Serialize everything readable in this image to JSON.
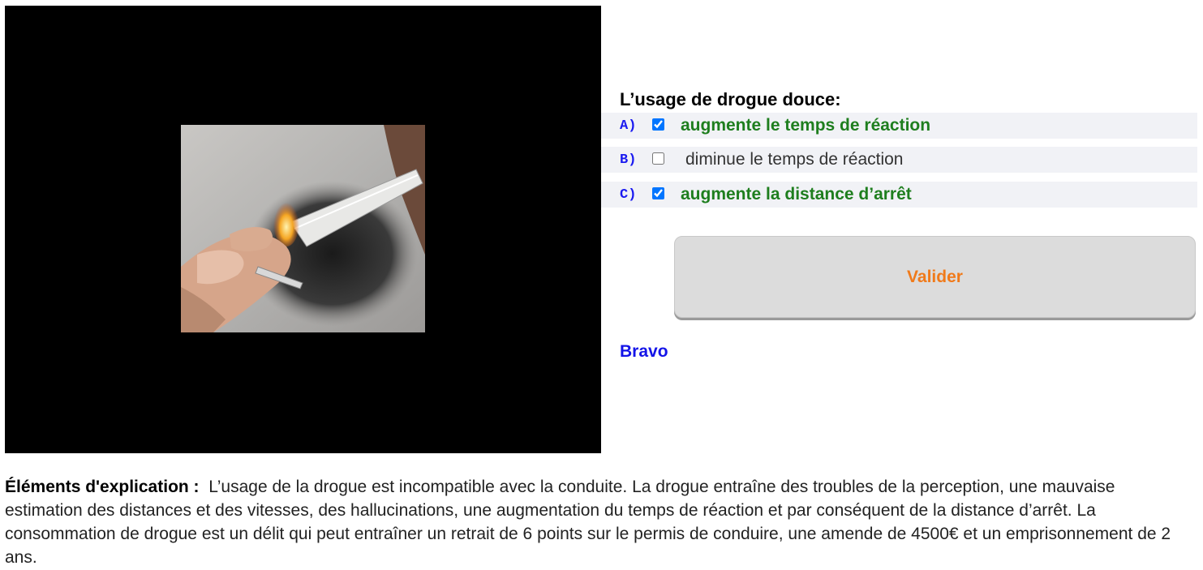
{
  "media": {
    "icon": "lighter-foil-photo"
  },
  "question": {
    "title": "L’usage de drogue douce:",
    "options": [
      {
        "letter": "A)",
        "label": "augmente le temps de réaction",
        "checked": true,
        "correct": true
      },
      {
        "letter": "B)",
        "label": "diminue le temps de réaction",
        "checked": false,
        "correct": false
      },
      {
        "letter": "C)",
        "label": "augmente la distance d’arrêt",
        "checked": true,
        "correct": true
      }
    ]
  },
  "actions": {
    "validate_label": "Valider"
  },
  "feedback": {
    "text": "Bravo"
  },
  "explanation": {
    "label": "Éléments d'explication :",
    "text": "L’usage de la drogue est incompatible avec la conduite. La drogue entraîne des troubles de la perception, une mauvaise estimation des distances et des vitesses, des hallucinations, une augmentation du temps de réaction et par conséquent de la distance d’arrêt. La consommation de drogue est un délit qui peut entraîner un retrait de 6 points sur le permis de conduire, une amende de 4500€ et un emprisonnement de 2 ans."
  },
  "colors": {
    "correct": "#1e7e1e",
    "letter": "#1a1af0",
    "button_text": "#f07a1a",
    "feedback": "#1414e8"
  }
}
